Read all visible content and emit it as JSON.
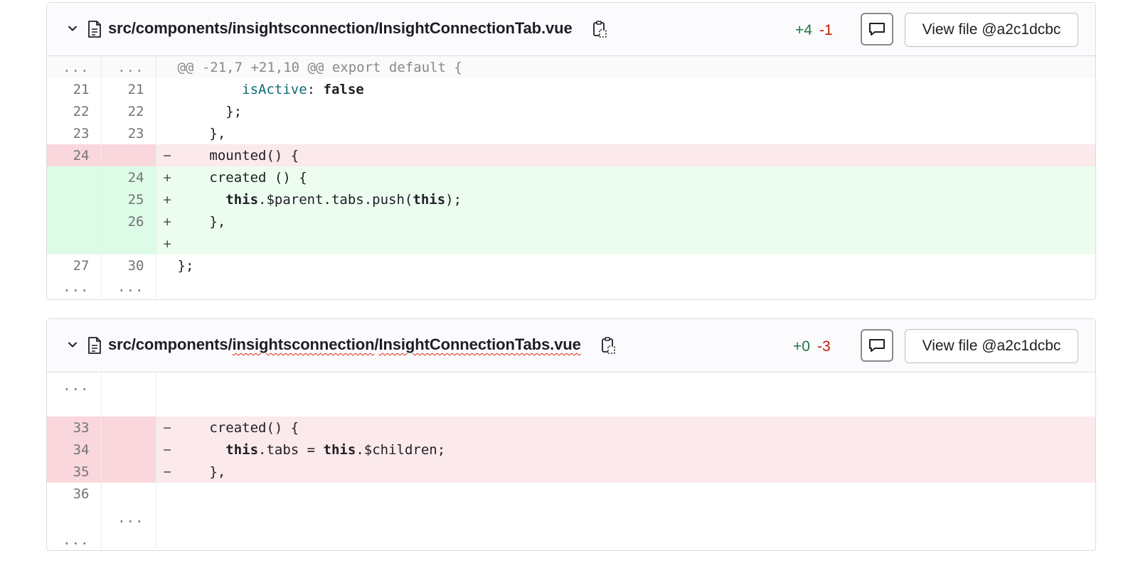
{
  "files": [
    {
      "path_prefix": "src/components/insightsconnection/InsightConnectionTab.vue",
      "additions": "+4",
      "deletions": "-1",
      "view_file_label": "View file @a2c1dcbc",
      "hunk_header": "@@ -21,7 +21,10 @@ export default {",
      "lines": [
        {
          "type": "match",
          "old": "...",
          "new": "...",
          "text": "@@ -21,7 +21,10 @@ export default {"
        },
        {
          "type": "context",
          "old": "21",
          "new": "21",
          "text": ""
        },
        {
          "type": "context",
          "old": "22",
          "new": "22",
          "text": "    };"
        },
        {
          "type": "context",
          "old": "23",
          "new": "23",
          "text": "  },"
        },
        {
          "type": "old",
          "old": "24",
          "new": "",
          "sign": "−",
          "text": "  mounted() {"
        },
        {
          "type": "new",
          "old": "",
          "new": "24",
          "sign": "+",
          "text": "  created () {"
        },
        {
          "type": "new",
          "old": "",
          "new": "25",
          "sign": "+",
          "text": ""
        },
        {
          "type": "new",
          "old": "",
          "new": "26",
          "sign": "+",
          "text": "  },"
        },
        {
          "type": "new",
          "old": "",
          "new": "",
          "sign": "+",
          "text": ""
        },
        {
          "type": "context",
          "old": "27",
          "new": "30",
          "text": "};"
        },
        {
          "type": "context",
          "old": "...",
          "new": "...",
          "text": ""
        }
      ],
      "line21_prop": "isActive",
      "line21_rest": ": ",
      "line21_kw": "false",
      "line25_kw1": "this",
      "line25_mid": ".$parent.tabs.push(",
      "line25_kw2": "this",
      "line25_end": ");"
    },
    {
      "path_a": "src/components/",
      "path_b": "insightsconnection",
      "path_c": "/",
      "path_d": "InsightConnectionTabs.vue",
      "additions": "+0",
      "deletions": "-3",
      "view_file_label": "View file @a2c1dcbc",
      "lines": [
        {
          "type": "context",
          "old": "...",
          "new": "",
          "text": ""
        },
        {
          "type": "old",
          "old": "33",
          "new": "",
          "sign": "−",
          "text": "  created() {"
        },
        {
          "type": "old",
          "old": "34",
          "new": "",
          "sign": "−",
          "text": ""
        },
        {
          "type": "old",
          "old": "35",
          "new": "",
          "sign": "−",
          "text": "  },"
        },
        {
          "type": "context",
          "old": "36",
          "new": "",
          "text": ""
        },
        {
          "type": "context",
          "old": "",
          "new": "...",
          "text": ""
        },
        {
          "type": "context",
          "old": "...",
          "new": "",
          "text": ""
        }
      ],
      "line34_kw1": "this",
      "line34_mid": ".tabs = ",
      "line34_kw2": "this",
      "line34_end": ".$children;"
    }
  ]
}
